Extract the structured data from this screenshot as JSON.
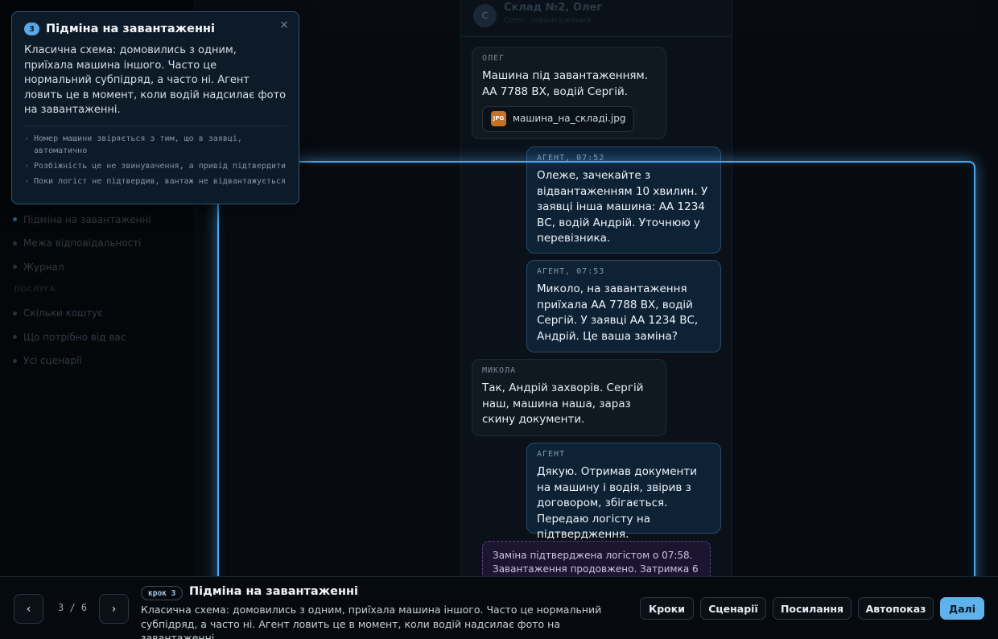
{
  "sidebar": {
    "items_top": [
      {
        "label": "Підміна на завантаженні",
        "active": true
      },
      {
        "label": "Межа відповідальності",
        "active": false
      },
      {
        "label": "Журнал",
        "active": false
      }
    ],
    "section_label": "ПОСЛУГА",
    "items_bottom": [
      {
        "label": "Скільки коштує"
      },
      {
        "label": "Що потрібно від вас"
      },
      {
        "label": "Усі сценарії"
      }
    ]
  },
  "chat": {
    "avatar": "С",
    "title": "Склад №2, Олег",
    "subtitle": "Олег, завантаження",
    "messages": [
      {
        "who": "ОЛЕГ",
        "text": "Машина під завантаженням. АА 7788 ВХ, водій Сергій.",
        "attachment": "машина_на_складі.jpg",
        "attachment_badge": "JPG"
      },
      {
        "who": "АГЕНТ, 07:52",
        "text": "Олеже, зачекайте з відвантаженням 10 хвилин. У заявці інша машина: АА 1234 ВС, водій Андрій. Уточнюю у перевізника."
      },
      {
        "who": "АГЕНТ, 07:53",
        "text": "Миколо, на завантаження приїхала АА 7788 ВХ, водій Сергій. У заявці АА 1234 ВС, Андрій. Це ваша заміна?"
      },
      {
        "who": "МИКОЛА",
        "text": "Так, Андрій захворів. Сергій наш, машина наша, зараз скину документи."
      },
      {
        "who": "АГЕНТ",
        "text": "Дякую. Отримав документи на машину і водія, звірив з договором, збігається. Передаю логісту на підтвердження."
      }
    ],
    "system_note": "Заміна підтверджена логістом о 07:58. Завантаження продовжено. Затримка 6"
  },
  "popover": {
    "step_number": "3",
    "title": "Підміна на завантаженні",
    "description": "Класична схема: домовились з одним, приїхала машина іншого. Часто це нормальний субпідряд, а часто ні. Агент ловить це в момент, коли водій надсилає фото на завантаженні.",
    "points": [
      "Номер машини звіряється з тим, що в заявці, автоматично",
      "Розбіжність це не звинувачення, а привід підтвердити",
      "Поки логіст не підтвердив, вантаж не відвантажується"
    ],
    "close_glyph": "×"
  },
  "bottom": {
    "prev_glyph": "‹",
    "next_glyph": "›",
    "counter": "3 / 6",
    "step_pill": "крок 3",
    "title": "Підміна на завантаженні",
    "description": "Класична схема: домовились з одним, приїхала машина іншого. Часто це нормальний субпідряд, а часто ні. Агент ловить це в момент, коли водій надсилає фото на завантаженні.",
    "buttons": {
      "steps": "Кроки",
      "scenarios": "Сценарії",
      "links": "Посилання",
      "autoplay": "Автопоказ",
      "next": "Далі"
    }
  },
  "colors": {
    "accent": "#4aa8f0",
    "primary_button": "#5fb2ec",
    "system_note_border": "#5a3f86",
    "attachment_badge": "#c4722a"
  }
}
